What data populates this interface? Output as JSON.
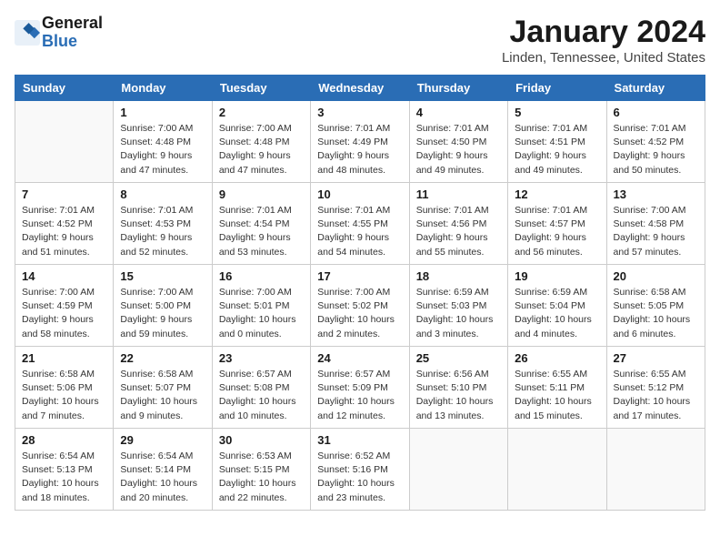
{
  "header": {
    "logo_line1": "General",
    "logo_line2": "Blue",
    "month": "January 2024",
    "location": "Linden, Tennessee, United States"
  },
  "weekdays": [
    "Sunday",
    "Monday",
    "Tuesday",
    "Wednesday",
    "Thursday",
    "Friday",
    "Saturday"
  ],
  "weeks": [
    [
      {
        "day": "",
        "info": ""
      },
      {
        "day": "1",
        "info": "Sunrise: 7:00 AM\nSunset: 4:48 PM\nDaylight: 9 hours\nand 47 minutes."
      },
      {
        "day": "2",
        "info": "Sunrise: 7:00 AM\nSunset: 4:48 PM\nDaylight: 9 hours\nand 47 minutes."
      },
      {
        "day": "3",
        "info": "Sunrise: 7:01 AM\nSunset: 4:49 PM\nDaylight: 9 hours\nand 48 minutes."
      },
      {
        "day": "4",
        "info": "Sunrise: 7:01 AM\nSunset: 4:50 PM\nDaylight: 9 hours\nand 49 minutes."
      },
      {
        "day": "5",
        "info": "Sunrise: 7:01 AM\nSunset: 4:51 PM\nDaylight: 9 hours\nand 49 minutes."
      },
      {
        "day": "6",
        "info": "Sunrise: 7:01 AM\nSunset: 4:52 PM\nDaylight: 9 hours\nand 50 minutes."
      }
    ],
    [
      {
        "day": "7",
        "info": ""
      },
      {
        "day": "8",
        "info": "Sunrise: 7:01 AM\nSunset: 4:53 PM\nDaylight: 9 hours\nand 52 minutes."
      },
      {
        "day": "9",
        "info": "Sunrise: 7:01 AM\nSunset: 4:54 PM\nDaylight: 9 hours\nand 53 minutes."
      },
      {
        "day": "10",
        "info": "Sunrise: 7:01 AM\nSunset: 4:55 PM\nDaylight: 9 hours\nand 54 minutes."
      },
      {
        "day": "11",
        "info": "Sunrise: 7:01 AM\nSunset: 4:56 PM\nDaylight: 9 hours\nand 55 minutes."
      },
      {
        "day": "12",
        "info": "Sunrise: 7:01 AM\nSunset: 4:57 PM\nDaylight: 9 hours\nand 56 minutes."
      },
      {
        "day": "13",
        "info": "Sunrise: 7:00 AM\nSunset: 4:58 PM\nDaylight: 9 hours\nand 57 minutes."
      }
    ],
    [
      {
        "day": "14",
        "info": ""
      },
      {
        "day": "15",
        "info": "Sunrise: 7:00 AM\nSunset: 5:00 PM\nDaylight: 9 hours\nand 59 minutes."
      },
      {
        "day": "16",
        "info": "Sunrise: 7:00 AM\nSunset: 5:01 PM\nDaylight: 10 hours\nand 0 minutes."
      },
      {
        "day": "17",
        "info": "Sunrise: 7:00 AM\nSunset: 5:02 PM\nDaylight: 10 hours\nand 2 minutes."
      },
      {
        "day": "18",
        "info": "Sunrise: 6:59 AM\nSunset: 5:03 PM\nDaylight: 10 hours\nand 3 minutes."
      },
      {
        "day": "19",
        "info": "Sunrise: 6:59 AM\nSunset: 5:04 PM\nDaylight: 10 hours\nand 4 minutes."
      },
      {
        "day": "20",
        "info": "Sunrise: 6:58 AM\nSunset: 5:05 PM\nDaylight: 10 hours\nand 6 minutes."
      }
    ],
    [
      {
        "day": "21",
        "info": ""
      },
      {
        "day": "22",
        "info": "Sunrise: 6:58 AM\nSunset: 5:07 PM\nDaylight: 10 hours\nand 9 minutes."
      },
      {
        "day": "23",
        "info": "Sunrise: 6:57 AM\nSunset: 5:08 PM\nDaylight: 10 hours\nand 10 minutes."
      },
      {
        "day": "24",
        "info": "Sunrise: 6:57 AM\nSunset: 5:09 PM\nDaylight: 10 hours\nand 12 minutes."
      },
      {
        "day": "25",
        "info": "Sunrise: 6:56 AM\nSunset: 5:10 PM\nDaylight: 10 hours\nand 13 minutes."
      },
      {
        "day": "26",
        "info": "Sunrise: 6:55 AM\nSunset: 5:11 PM\nDaylight: 10 hours\nand 15 minutes."
      },
      {
        "day": "27",
        "info": "Sunrise: 6:55 AM\nSunset: 5:12 PM\nDaylight: 10 hours\nand 17 minutes."
      }
    ],
    [
      {
        "day": "28",
        "info": ""
      },
      {
        "day": "29",
        "info": "Sunrise: 6:54 AM\nSunset: 5:14 PM\nDaylight: 10 hours\nand 20 minutes."
      },
      {
        "day": "30",
        "info": "Sunrise: 6:53 AM\nSunset: 5:15 PM\nDaylight: 10 hours\nand 22 minutes."
      },
      {
        "day": "31",
        "info": "Sunrise: 6:52 AM\nSunset: 5:16 PM\nDaylight: 10 hours\nand 23 minutes."
      },
      {
        "day": "",
        "info": ""
      },
      {
        "day": "",
        "info": ""
      },
      {
        "day": "",
        "info": ""
      }
    ]
  ],
  "week1_day7_info": "Sunrise: 7:01 AM\nSunset: 4:52 PM\nDaylight: 9 hours\nand 51 minutes.",
  "week2_day1_info": "Sunrise: 7:01 AM\nSunset: 4:52 PM\nDaylight: 9 hours\nand 51 minutes.",
  "week3_day1_info": "Sunrise: 7:00 AM\nSunset: 4:59 PM\nDaylight: 9 hours\nand 58 minutes.",
  "week4_day1_info": "Sunrise: 6:58 AM\nSunset: 5:06 PM\nDaylight: 10 hours\nand 7 minutes.",
  "week5_day1_info": "Sunrise: 6:54 AM\nSunset: 5:13 PM\nDaylight: 10 hours\nand 18 minutes."
}
